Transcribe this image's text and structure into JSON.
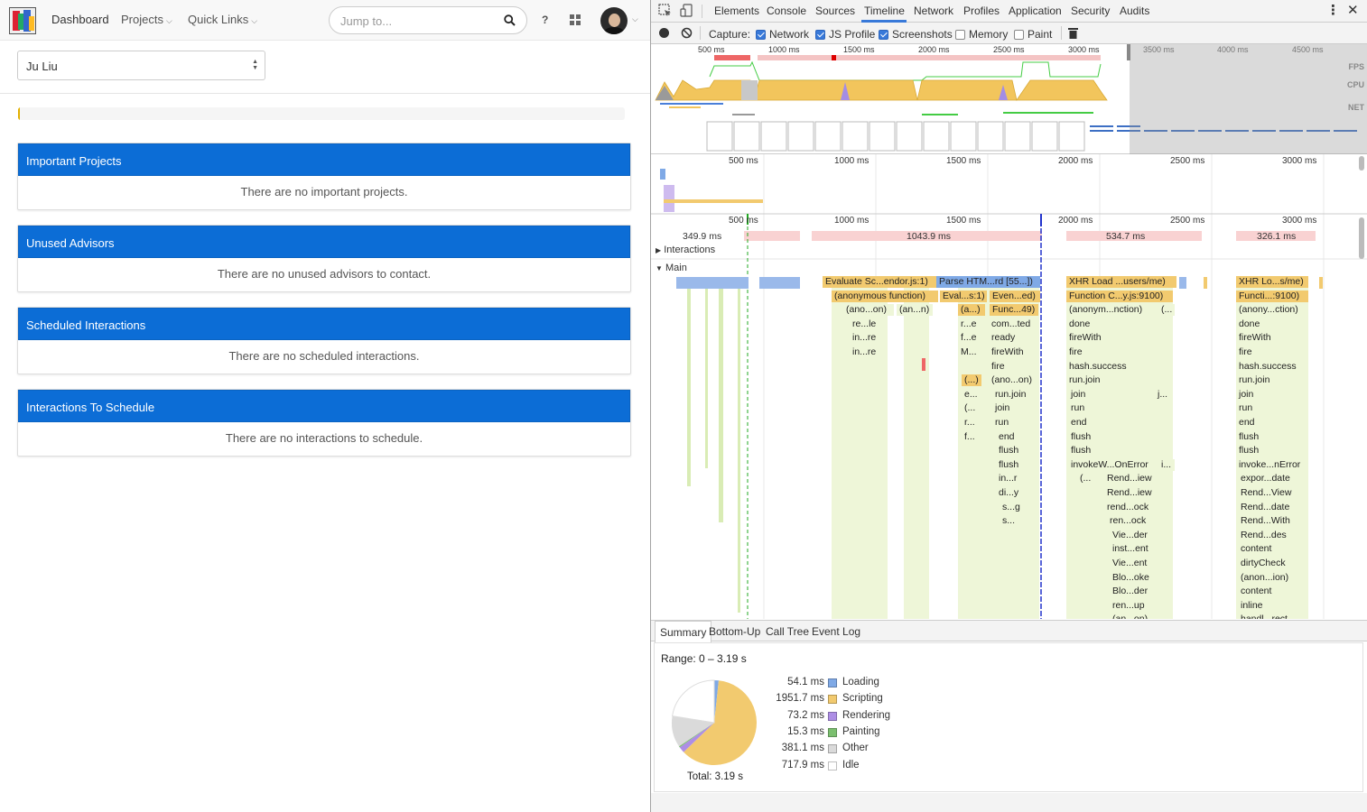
{
  "app": {
    "nav": {
      "dashboard": "Dashboard",
      "projects": "Projects",
      "quick_links": "Quick Links",
      "search_placeholder": "Jump to...",
      "help": "?"
    },
    "user_select": {
      "value": "Ju Liu"
    },
    "progress_fraction": 0.003,
    "panels": [
      {
        "title": "Important Projects",
        "empty": "There are no important projects."
      },
      {
        "title": "Unused Advisors",
        "empty": "There are no unused advisors to contact."
      },
      {
        "title": "Scheduled Interactions",
        "empty": "There are no scheduled interactions."
      },
      {
        "title": "Interactions To Schedule",
        "empty": "There are no interactions to schedule."
      }
    ],
    "colors": {
      "panel_header": "#0c6dd6"
    }
  },
  "devtools": {
    "tabs": [
      "Elements",
      "Console",
      "Sources",
      "Timeline",
      "Network",
      "Profiles",
      "Application",
      "Security",
      "Audits"
    ],
    "active_tab": "Timeline",
    "capture": {
      "label": "Capture:",
      "options": [
        {
          "label": "Network",
          "checked": true
        },
        {
          "label": "JS Profile",
          "checked": true
        },
        {
          "label": "Screenshots",
          "checked": true
        },
        {
          "label": "Memory",
          "checked": false
        },
        {
          "label": "Paint",
          "checked": false
        }
      ]
    },
    "overview": {
      "ticks": [
        "500 ms",
        "1000 ms",
        "1500 ms",
        "2000 ms",
        "2500 ms",
        "3000 ms",
        "3500 ms",
        "4000 ms",
        "4500 ms"
      ],
      "labels": {
        "fps": "FPS",
        "cpu": "CPU",
        "net": "NET"
      }
    },
    "flame_ticks": [
      "500 ms",
      "1000 ms",
      "1500 ms",
      "2000 ms",
      "2500 ms",
      "3000 ms"
    ],
    "frames": [
      "349.9 ms",
      "1043.9 ms",
      "534.7 ms",
      "326.1 ms"
    ],
    "sections": {
      "interactions": "Interactions",
      "main": "Main"
    },
    "flame_blocks": [
      {
        "t": "Evaluate Sc...endor.js:1)"
      },
      {
        "t": "Parse HTM...rd [55...])"
      },
      {
        "t": "XHR Load ...users/me)"
      },
      {
        "t": "XHR Lo...s/me)"
      },
      {
        "t": "(anonymous function)"
      },
      {
        "t": "Eval...s:1)"
      },
      {
        "t": "Even...ed)"
      },
      {
        "t": "Function C...y.js:9100)"
      },
      {
        "t": "Functi...:9100)"
      },
      {
        "t": "(ano...on)"
      },
      {
        "t": "(an...n)"
      },
      {
        "t": "(a...)"
      },
      {
        "t": "Func...49)"
      },
      {
        "t": "(anonym...nction)"
      },
      {
        "t": "(..."
      },
      {
        "t": "(anony...ction)"
      },
      {
        "t": "re...le"
      },
      {
        "t": "r...e"
      },
      {
        "t": "com...ted"
      },
      {
        "t": "done"
      },
      {
        "t": "done"
      },
      {
        "t": "in...re"
      },
      {
        "t": "f...e"
      },
      {
        "t": "ready"
      },
      {
        "t": "fireWith"
      },
      {
        "t": "fireWith"
      },
      {
        "t": "in...re"
      },
      {
        "t": "M..."
      },
      {
        "t": "fireWith"
      },
      {
        "t": "fire"
      },
      {
        "t": "fire"
      },
      {
        "t": "fire"
      },
      {
        "t": "hash.success"
      },
      {
        "t": "hash.success"
      },
      {
        "t": "(...)"
      },
      {
        "t": "(ano...on)"
      },
      {
        "t": "run.join"
      },
      {
        "t": "run.join"
      },
      {
        "t": "e..."
      },
      {
        "t": "run.join"
      },
      {
        "t": "join"
      },
      {
        "t": "j..."
      },
      {
        "t": "join"
      },
      {
        "t": "(..."
      },
      {
        "t": "join"
      },
      {
        "t": "run"
      },
      {
        "t": "run"
      },
      {
        "t": "r..."
      },
      {
        "t": "run"
      },
      {
        "t": "end"
      },
      {
        "t": "end"
      },
      {
        "t": "f..."
      },
      {
        "t": "end"
      },
      {
        "t": "flush"
      },
      {
        "t": "flush"
      },
      {
        "t": "flush"
      },
      {
        "t": "flush"
      },
      {
        "t": "flush"
      },
      {
        "t": "flush"
      },
      {
        "t": "invokeW...OnError"
      },
      {
        "t": "i..."
      },
      {
        "t": "invoke...nError"
      },
      {
        "t": "in...r"
      },
      {
        "t": "(..."
      },
      {
        "t": "Rend...iew"
      },
      {
        "t": "expor...date"
      },
      {
        "t": "di...y"
      },
      {
        "t": "Rend...iew"
      },
      {
        "t": "Rend...View"
      },
      {
        "t": "s...g"
      },
      {
        "t": "rend...ock"
      },
      {
        "t": "Rend...date"
      },
      {
        "t": "s..."
      },
      {
        "t": "ren...ock"
      },
      {
        "t": "Rend...With"
      },
      {
        "t": "Vie...der"
      },
      {
        "t": "Rend...des"
      },
      {
        "t": "inst...ent"
      },
      {
        "t": "content"
      },
      {
        "t": "Vie...ent"
      },
      {
        "t": "dirtyCheck"
      },
      {
        "t": "Blo...oke"
      },
      {
        "t": "(anon...ion)"
      },
      {
        "t": "Blo...der"
      },
      {
        "t": "content"
      },
      {
        "t": "ren...up"
      },
      {
        "t": "inline"
      },
      {
        "t": "(an...on)"
      },
      {
        "t": "handl...rect"
      }
    ],
    "bottom_tabs": [
      "Summary",
      "Bottom-Up",
      "Call Tree",
      "Event Log"
    ],
    "active_bottom_tab": "Summary",
    "summary": {
      "range": "Range: 0 – 3.19 s",
      "total": "Total: 3.19 s",
      "rows": [
        {
          "ms": "54.1 ms",
          "name": "Loading",
          "color": "#7fa9e6",
          "value": 54.1
        },
        {
          "ms": "1951.7 ms",
          "name": "Scripting",
          "color": "#f2ca6f",
          "value": 1951.7
        },
        {
          "ms": "73.2 ms",
          "name": "Rendering",
          "color": "#ad8ee5",
          "value": 73.2
        },
        {
          "ms": "15.3 ms",
          "name": "Painting",
          "color": "#7bbf6f",
          "value": 15.3
        },
        {
          "ms": "381.1 ms",
          "name": "Other",
          "color": "#dadada",
          "value": 381.1
        },
        {
          "ms": "717.9 ms",
          "name": "Idle",
          "color": "#ffffff",
          "value": 717.9
        }
      ]
    }
  }
}
